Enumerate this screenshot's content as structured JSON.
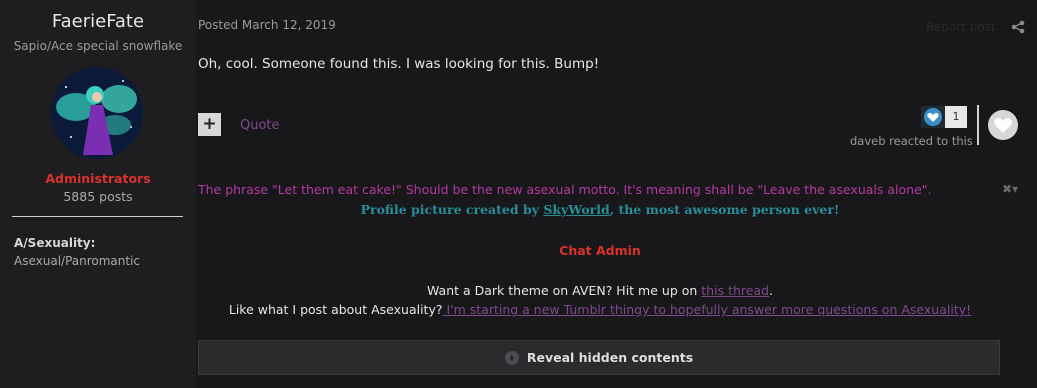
{
  "author": {
    "name": "FaerieFate",
    "title": "Sapio/Ace special snowflake",
    "group": "Administrators",
    "posts": "5885 posts",
    "field_label": "A/Sexuality:",
    "field_value": "Asexual/Panromantic"
  },
  "post": {
    "meta": "Posted March 12, 2019",
    "report_label": "Report post",
    "content": "Oh, cool. Someone found this. I was looking for this. Bump!",
    "quote_label": "Quote",
    "reaction_count": "1",
    "reacted_text": "daveb reacted to this"
  },
  "signature": {
    "motto": "The phrase \"Let them eat cake!\" Should be the new asexual motto. It's meaning shall be \"Leave the asexuals alone\".",
    "credit_prefix": "Profile picture created by ",
    "credit_link": "SkyWorld",
    "credit_suffix": ", the most awesome person ever!",
    "chat_admin": "Chat Admin",
    "dark_prefix": "Want a Dark theme on AVEN? Hit me up on ",
    "dark_link": "this thread",
    "dark_suffix": ".",
    "tumblr_prefix": "Like what I post about Asexuality?",
    "tumblr_link": " I'm starting a new Tumblr thingy to hopefully answer more questions on Asexuality!",
    "reveal_label": "Reveal hidden contents"
  }
}
